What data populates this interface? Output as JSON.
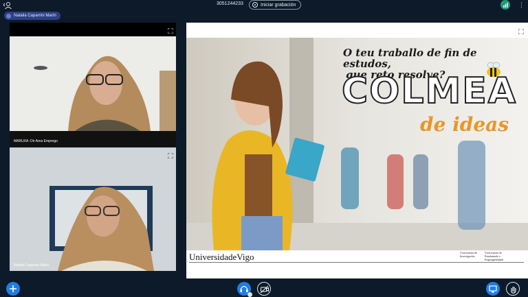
{
  "topbar": {
    "meeting_id": "3051244233",
    "record_label": "Iniciar grabación"
  },
  "presenter": {
    "name": "Natalia Caparrini Marín"
  },
  "participants": [
    {
      "name": "MARUXA -Dir Area Emprego"
    },
    {
      "name": "Natalia Caparrini Marín"
    }
  ],
  "slide": {
    "headline_line1": "O teu traballo de fin de estudos,",
    "headline_line2": "que reto resolve?",
    "brand_main": "COLMEA",
    "brand_sub": "de ideas",
    "logo_text": "UniversidadeVigo",
    "footer_left": "Vicerreitoría de Investigación",
    "footer_right": "Vicerreitoría de Estudantado e Empregabilidade"
  },
  "colors": {
    "background": "#0d1a29",
    "accent_blue": "#1f7ee6",
    "presenter_chip": "#2e3f86",
    "brand_orange": "#e99629",
    "signal_green": "#1f9a7a"
  },
  "icons": {
    "user": "person-icon",
    "record": "record-icon",
    "signal": "signal-icon",
    "more": "more-icon",
    "expand": "expand-icon",
    "add": "plus-icon",
    "audio": "headphones-icon",
    "video": "camera-off-icon",
    "screen": "screen-share-icon",
    "hand": "raise-hand-icon"
  }
}
